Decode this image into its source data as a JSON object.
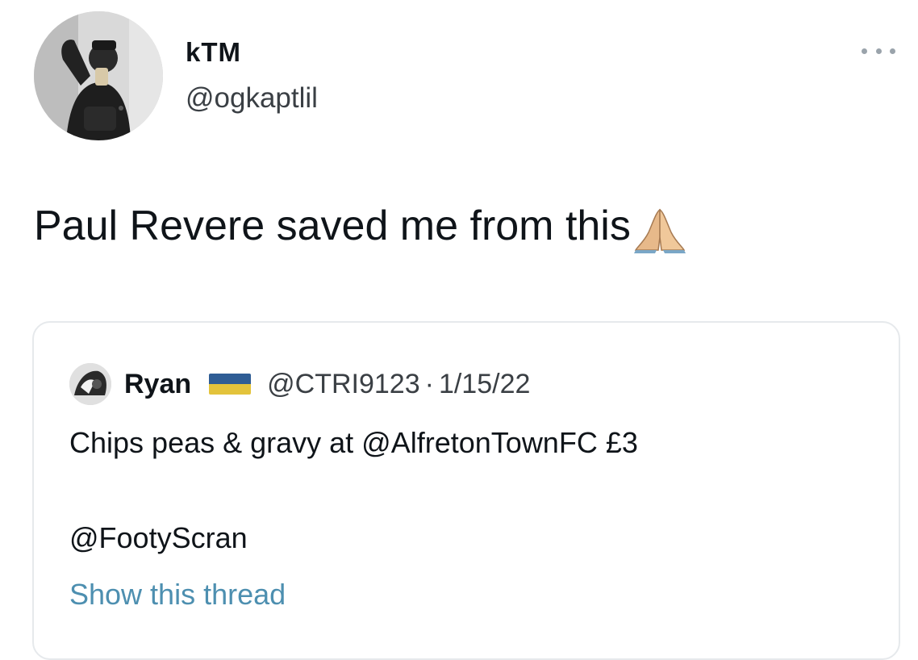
{
  "tweet": {
    "display_name": "kTM",
    "handle": "@ogkaptlil",
    "text": "Paul Revere saved me from this",
    "emoji": "folded-hands-emoji",
    "more_icon": "more-horizontal-icon"
  },
  "quoted_tweet": {
    "display_name": "Ryan",
    "flag": "ukraine-flag",
    "flag_colors": {
      "top": "#2f5d95",
      "bottom": "#e3c33c"
    },
    "handle": "@CTRI9123",
    "separator": "·",
    "date": "1/15/22",
    "text_line1": "Chips peas & gravy at @AlfretonTownFC £3",
    "text_line2": "@FootyScran",
    "show_thread_label": "Show this thread"
  },
  "colors": {
    "text_primary": "#0f1419",
    "text_secondary": "#3a3f44",
    "link": "#4d8fb0",
    "card_border": "#e6e9ec"
  }
}
